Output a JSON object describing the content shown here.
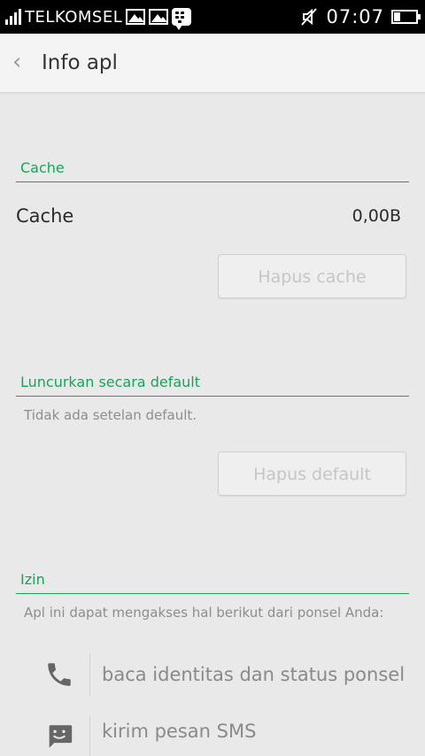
{
  "statusbar": {
    "carrier": "TELKOMSEL",
    "time": "07:07",
    "icons": [
      "signal-icon",
      "image-icon",
      "image-icon",
      "bbm-icon",
      "mute-icon",
      "battery-icon"
    ],
    "battery_level": 0.3
  },
  "header": {
    "title": "Info apl"
  },
  "cache": {
    "section_title": "Cache",
    "row_label": "Cache",
    "row_value": "0,00B",
    "button_label": "Hapus cache"
  },
  "launch": {
    "section_title": "Luncurkan secara default",
    "description": "Tidak ada setelan default.",
    "button_label": "Hapus default"
  },
  "permissions": {
    "section_title": "Izin",
    "description": "Apl ini dapat mengakses hal berikut dari ponsel Anda:",
    "items": [
      {
        "icon": "phone-icon",
        "label": "baca identitas dan status ponsel"
      },
      {
        "icon": "sms-icon",
        "label": "kirim pesan SMS"
      }
    ]
  },
  "colors": {
    "accent": "#19a35a",
    "warning": "#f3b52a"
  }
}
